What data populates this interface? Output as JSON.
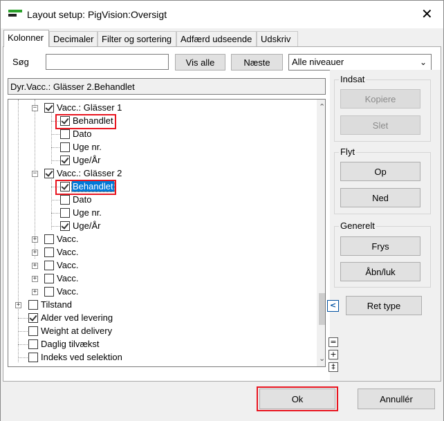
{
  "window": {
    "title": "Layout setup: PigVision:Oversigt",
    "close_glyph": "✕"
  },
  "tabs": [
    "Kolonner",
    "Decimaler",
    "Filter og sortering",
    "Adfærd  udseende",
    "Udskriv"
  ],
  "search": {
    "label": "Søg",
    "value": "",
    "show_all": "Vis alle",
    "next": "Næste",
    "level_select": "Alle niveauer"
  },
  "path": "Dyr.Vacc.: Glässer 2.Behandlet",
  "tree": [
    {
      "label": "Vacc.: Glässer 1",
      "toggle": "−",
      "checked": true
    },
    {
      "label": "Behandlet",
      "checked": true
    },
    {
      "label": "Dato",
      "checked": false
    },
    {
      "label": "Uge nr.",
      "checked": false
    },
    {
      "label": "Uge/År",
      "checked": true
    },
    {
      "label": "Vacc.: Glässer 2",
      "toggle": "−",
      "checked": true
    },
    {
      "label": "Behandlet",
      "checked": true,
      "selected": true
    },
    {
      "label": "Dato",
      "checked": false
    },
    {
      "label": "Uge nr.",
      "checked": false
    },
    {
      "label": "Uge/År",
      "checked": true
    },
    {
      "label": "Vacc.",
      "toggle": "+",
      "checked": false
    },
    {
      "label": "Vacc.",
      "toggle": "+",
      "checked": false
    },
    {
      "label": "Vacc.",
      "toggle": "+",
      "checked": false
    },
    {
      "label": "Vacc.",
      "toggle": "+",
      "checked": false
    },
    {
      "label": "Vacc.",
      "toggle": "+",
      "checked": false
    },
    {
      "label": "Tilstand",
      "toggle": "+",
      "checked": false
    },
    {
      "label": "Alder ved levering",
      "checked": true
    },
    {
      "label": "Weight at delivery",
      "checked": false
    },
    {
      "label": "Daglig tilvækst",
      "checked": false
    },
    {
      "label": "Indeks ved selektion",
      "checked": false
    }
  ],
  "groups": {
    "indsat": {
      "label": "Indsat",
      "copy": "Kopiere",
      "delete": "Slet"
    },
    "flyt": {
      "label": "Flyt",
      "up": "Op",
      "down": "Ned"
    },
    "generelt": {
      "label": "Generelt",
      "freeze": "Frys",
      "open_close": "Åbn/luk"
    }
  },
  "collapse_glyph": "<",
  "edit_type": "Ret type",
  "mini_buttons": [
    "=",
    "+",
    "‡"
  ],
  "footer": {
    "ok": "Ok",
    "cancel": "Annullér"
  },
  "colors": {
    "highlight": "#e8141f",
    "selection": "#0078d7",
    "accent_icon": "#2aa02a"
  }
}
